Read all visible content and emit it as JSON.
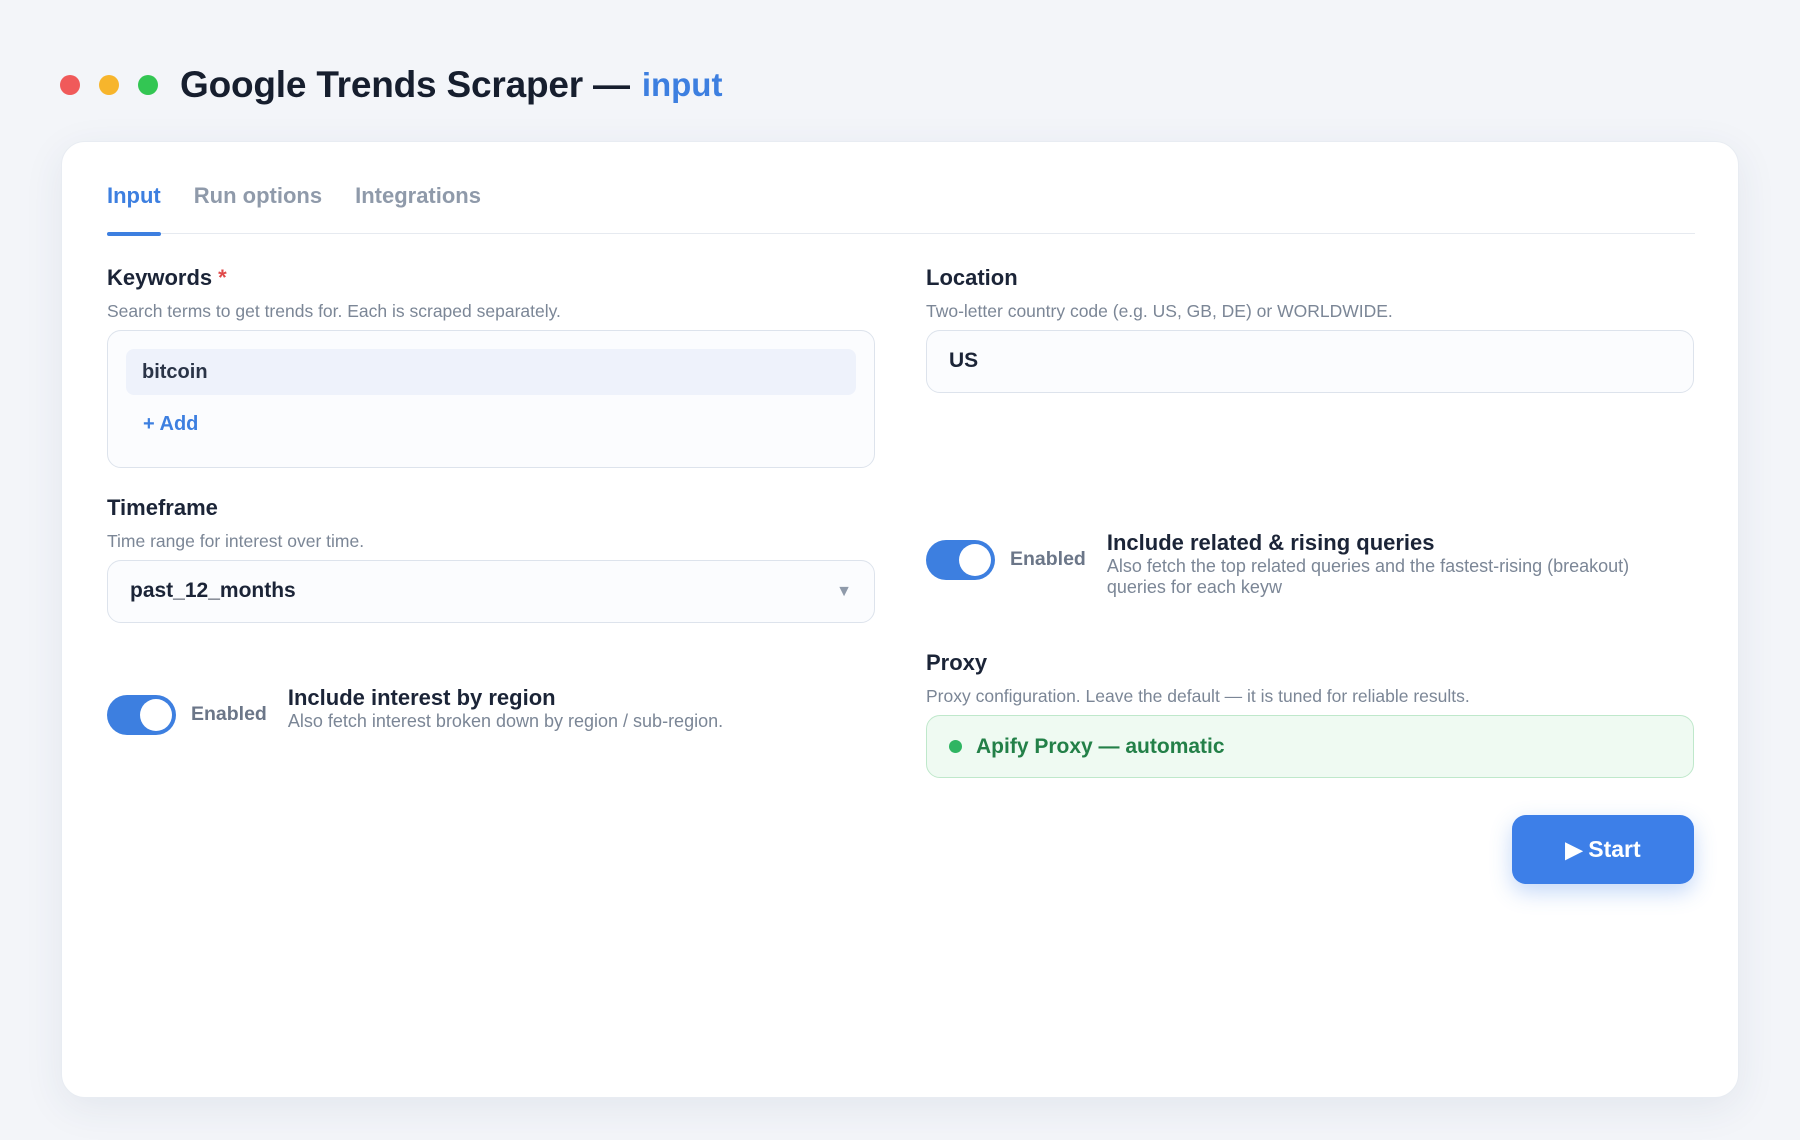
{
  "window": {
    "title": "Google Trends Scraper —",
    "subtitle": "input"
  },
  "tabs": [
    {
      "label": "Input",
      "active": true
    },
    {
      "label": "Run options",
      "active": false
    },
    {
      "label": "Integrations",
      "active": false
    }
  ],
  "keywords": {
    "label": "Keywords",
    "required_mark": "*",
    "help": "Search terms to get trends for. Each is scraped separately.",
    "items": [
      "bitcoin"
    ],
    "add_label": "+ Add"
  },
  "location": {
    "label": "Location",
    "help": "Two-letter country code (e.g. US, GB, DE) or WORLDWIDE.",
    "value": "US"
  },
  "timeframe": {
    "label": "Timeframe",
    "help": "Time range for interest over time.",
    "value": "past_12_months"
  },
  "related_queries": {
    "state": "Enabled",
    "enabled": true,
    "title": "Include related & rising queries",
    "description": "Also fetch the top related queries and the fastest-rising (breakout) queries for each keyw"
  },
  "interest_by_region": {
    "state": "Enabled",
    "enabled": true,
    "title": "Include interest by region",
    "description": "Also fetch interest broken down by region / sub-region."
  },
  "proxy": {
    "label": "Proxy",
    "help": "Proxy configuration. Leave the default — it is tuned for reliable results.",
    "value": "Apify Proxy — automatic",
    "status_color": "#2fb562"
  },
  "actions": {
    "start_icon": "▶",
    "start_label": "Start"
  },
  "colors": {
    "accent": "#3d7fe0",
    "required": "#e04a4a",
    "success": "#238048"
  }
}
